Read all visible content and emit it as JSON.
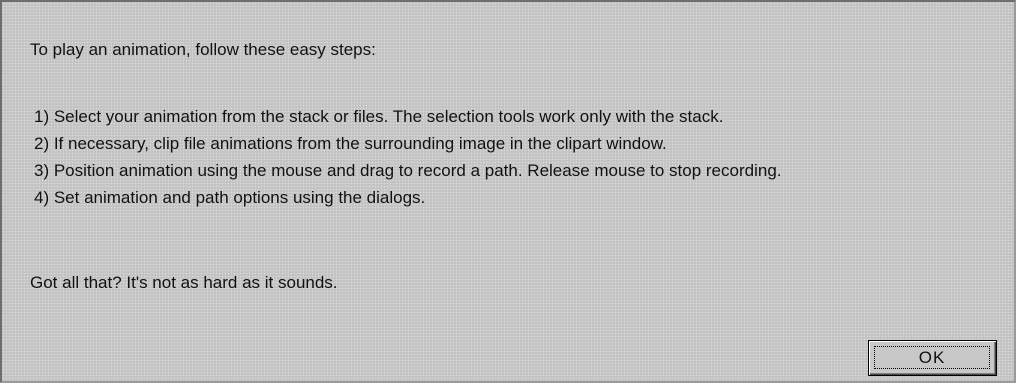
{
  "dialog": {
    "intro": "To play an animation, follow these easy steps:",
    "steps": [
      "1) Select your animation from the stack or files.  The selection tools work only with the stack.",
      "2) If necessary, clip file animations from the surrounding image in the clipart window.",
      "3) Position animation using the mouse and drag to record a path.  Release mouse to stop recording.",
      "4) Set animation and path options using the dialogs."
    ],
    "outro": "Got all that?  It's not as hard as it sounds.",
    "ok_label": "OK"
  },
  "colors": {
    "dialog_background": "#c8c8c8",
    "text": "#111111"
  }
}
